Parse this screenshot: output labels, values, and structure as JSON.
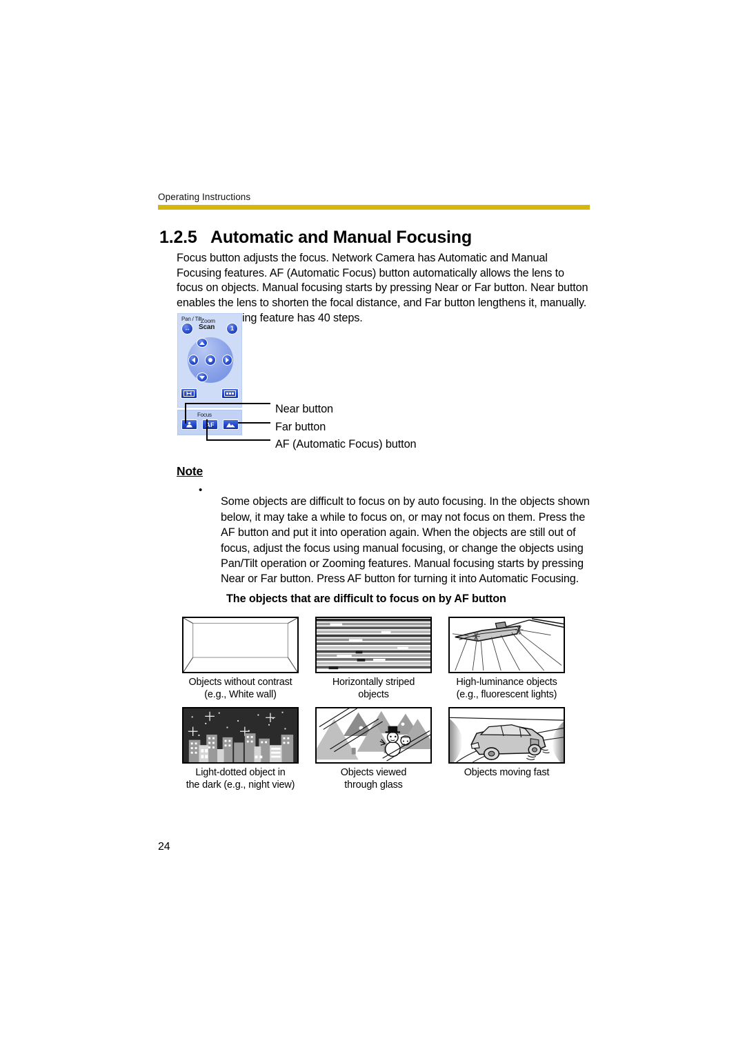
{
  "page": {
    "running_head": "Operating Instructions",
    "page_number": "24",
    "rule_color": "#d6b60c"
  },
  "section": {
    "number": "1.2.5",
    "title": "Automatic and Manual Focusing",
    "intro": "Focus button adjusts the focus. Network Camera has Automatic and Manual Focusing features. AF (Automatic Focus) button automatically allows the lens to focus on objects. Manual focusing starts by pressing Near or Far button. Near button enables the lens to shorten the focal distance, and Far button lengthens it, manually. Manual focusing feature has 40 steps."
  },
  "control_panel": {
    "pantilt_label": "Pan / Tilt",
    "scan_label": "Scan",
    "zoom_label": "Zoom",
    "focus_label": "Focus",
    "home_label": "1",
    "af_label": "AF",
    "panel_bg": "#cfdcf7",
    "focus_bg": "#c2d2f4",
    "button_blue": "#2448c6",
    "buttons": {
      "scan_left": "scan-button",
      "home": "home-position-button",
      "up": "tilt-up-button",
      "down": "tilt-down-button",
      "left": "pan-left-button",
      "right": "pan-right-button",
      "center": "home-center-button",
      "zoom_wide": "zoom-wide-button",
      "zoom_tele": "zoom-tele-button",
      "near": "near-focus-button",
      "af": "af-button",
      "far": "far-focus-button"
    }
  },
  "callouts": [
    {
      "label": "Near button"
    },
    {
      "label": "Far button"
    },
    {
      "label": "AF (Automatic Focus) button"
    }
  ],
  "note": {
    "heading": "Note",
    "bullet": "•",
    "text": "Some objects are difficult to focus on by auto focusing. In the objects shown below, it may take a while to focus on, or may not focus on them. Press the AF button and put it into operation again. When the objects are still out of focus, adjust the focus using manual focusing, or change the objects using Pan/Tilt operation or Zooming features. Manual focusing starts by pressing Near or Far button. Press AF button for turning it into Automatic Focusing.",
    "subheading": "The objects that are difficult to focus on by AF button"
  },
  "figures": [
    [
      {
        "icon": "white-wall-illustration",
        "caption_line1": "Objects without contrast",
        "caption_line2": "(e.g., White wall)"
      },
      {
        "icon": "horizontal-stripes-illustration",
        "caption_line1": "Horizontally striped",
        "caption_line2": "objects"
      },
      {
        "icon": "fluorescent-light-illustration",
        "caption_line1": "High-luminance objects",
        "caption_line2": "(e.g., fluorescent lights)"
      }
    ],
    [
      {
        "icon": "night-city-illustration",
        "caption_line1": "Light-dotted object in",
        "caption_line2": "the dark (e.g., night view)"
      },
      {
        "icon": "snowman-through-glass-illustration",
        "caption_line1": "Objects viewed",
        "caption_line2": "through glass"
      },
      {
        "icon": "moving-car-illustration",
        "caption_line1": "Objects moving fast",
        "caption_line2": ""
      }
    ]
  ]
}
